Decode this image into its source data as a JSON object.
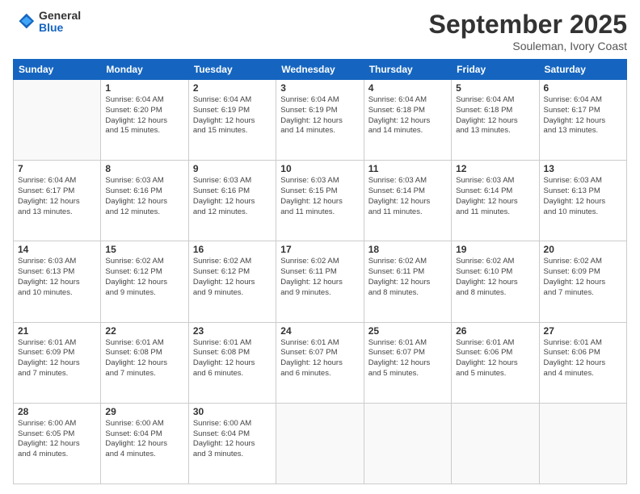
{
  "logo": {
    "general": "General",
    "blue": "Blue"
  },
  "header": {
    "month": "September 2025",
    "location": "Souleman, Ivory Coast"
  },
  "weekdays": [
    "Sunday",
    "Monday",
    "Tuesday",
    "Wednesday",
    "Thursday",
    "Friday",
    "Saturday"
  ],
  "weeks": [
    [
      {
        "day": "",
        "info": ""
      },
      {
        "day": "1",
        "info": "Sunrise: 6:04 AM\nSunset: 6:20 PM\nDaylight: 12 hours\nand 15 minutes."
      },
      {
        "day": "2",
        "info": "Sunrise: 6:04 AM\nSunset: 6:19 PM\nDaylight: 12 hours\nand 15 minutes."
      },
      {
        "day": "3",
        "info": "Sunrise: 6:04 AM\nSunset: 6:19 PM\nDaylight: 12 hours\nand 14 minutes."
      },
      {
        "day": "4",
        "info": "Sunrise: 6:04 AM\nSunset: 6:18 PM\nDaylight: 12 hours\nand 14 minutes."
      },
      {
        "day": "5",
        "info": "Sunrise: 6:04 AM\nSunset: 6:18 PM\nDaylight: 12 hours\nand 13 minutes."
      },
      {
        "day": "6",
        "info": "Sunrise: 6:04 AM\nSunset: 6:17 PM\nDaylight: 12 hours\nand 13 minutes."
      }
    ],
    [
      {
        "day": "7",
        "info": "Sunrise: 6:04 AM\nSunset: 6:17 PM\nDaylight: 12 hours\nand 13 minutes."
      },
      {
        "day": "8",
        "info": "Sunrise: 6:03 AM\nSunset: 6:16 PM\nDaylight: 12 hours\nand 12 minutes."
      },
      {
        "day": "9",
        "info": "Sunrise: 6:03 AM\nSunset: 6:16 PM\nDaylight: 12 hours\nand 12 minutes."
      },
      {
        "day": "10",
        "info": "Sunrise: 6:03 AM\nSunset: 6:15 PM\nDaylight: 12 hours\nand 11 minutes."
      },
      {
        "day": "11",
        "info": "Sunrise: 6:03 AM\nSunset: 6:14 PM\nDaylight: 12 hours\nand 11 minutes."
      },
      {
        "day": "12",
        "info": "Sunrise: 6:03 AM\nSunset: 6:14 PM\nDaylight: 12 hours\nand 11 minutes."
      },
      {
        "day": "13",
        "info": "Sunrise: 6:03 AM\nSunset: 6:13 PM\nDaylight: 12 hours\nand 10 minutes."
      }
    ],
    [
      {
        "day": "14",
        "info": "Sunrise: 6:03 AM\nSunset: 6:13 PM\nDaylight: 12 hours\nand 10 minutes."
      },
      {
        "day": "15",
        "info": "Sunrise: 6:02 AM\nSunset: 6:12 PM\nDaylight: 12 hours\nand 9 minutes."
      },
      {
        "day": "16",
        "info": "Sunrise: 6:02 AM\nSunset: 6:12 PM\nDaylight: 12 hours\nand 9 minutes."
      },
      {
        "day": "17",
        "info": "Sunrise: 6:02 AM\nSunset: 6:11 PM\nDaylight: 12 hours\nand 9 minutes."
      },
      {
        "day": "18",
        "info": "Sunrise: 6:02 AM\nSunset: 6:11 PM\nDaylight: 12 hours\nand 8 minutes."
      },
      {
        "day": "19",
        "info": "Sunrise: 6:02 AM\nSunset: 6:10 PM\nDaylight: 12 hours\nand 8 minutes."
      },
      {
        "day": "20",
        "info": "Sunrise: 6:02 AM\nSunset: 6:09 PM\nDaylight: 12 hours\nand 7 minutes."
      }
    ],
    [
      {
        "day": "21",
        "info": "Sunrise: 6:01 AM\nSunset: 6:09 PM\nDaylight: 12 hours\nand 7 minutes."
      },
      {
        "day": "22",
        "info": "Sunrise: 6:01 AM\nSunset: 6:08 PM\nDaylight: 12 hours\nand 7 minutes."
      },
      {
        "day": "23",
        "info": "Sunrise: 6:01 AM\nSunset: 6:08 PM\nDaylight: 12 hours\nand 6 minutes."
      },
      {
        "day": "24",
        "info": "Sunrise: 6:01 AM\nSunset: 6:07 PM\nDaylight: 12 hours\nand 6 minutes."
      },
      {
        "day": "25",
        "info": "Sunrise: 6:01 AM\nSunset: 6:07 PM\nDaylight: 12 hours\nand 5 minutes."
      },
      {
        "day": "26",
        "info": "Sunrise: 6:01 AM\nSunset: 6:06 PM\nDaylight: 12 hours\nand 5 minutes."
      },
      {
        "day": "27",
        "info": "Sunrise: 6:01 AM\nSunset: 6:06 PM\nDaylight: 12 hours\nand 4 minutes."
      }
    ],
    [
      {
        "day": "28",
        "info": "Sunrise: 6:00 AM\nSunset: 6:05 PM\nDaylight: 12 hours\nand 4 minutes."
      },
      {
        "day": "29",
        "info": "Sunrise: 6:00 AM\nSunset: 6:04 PM\nDaylight: 12 hours\nand 4 minutes."
      },
      {
        "day": "30",
        "info": "Sunrise: 6:00 AM\nSunset: 6:04 PM\nDaylight: 12 hours\nand 3 minutes."
      },
      {
        "day": "",
        "info": ""
      },
      {
        "day": "",
        "info": ""
      },
      {
        "day": "",
        "info": ""
      },
      {
        "day": "",
        "info": ""
      }
    ]
  ]
}
